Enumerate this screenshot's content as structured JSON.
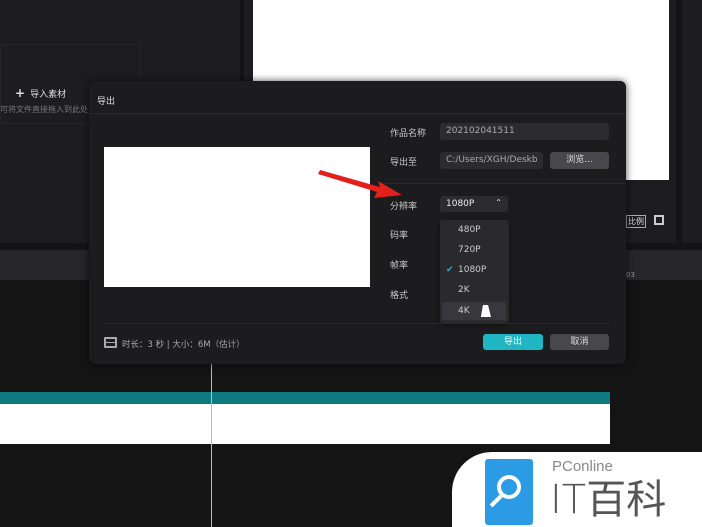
{
  "media_panel": {
    "import_label": "导入素材",
    "hint": "可将文件直接拖入到此处"
  },
  "dialog": {
    "title": "导出",
    "name_label": "作品名称",
    "name_value": "202102041511",
    "export_to_label": "导出至",
    "export_path": "C:/Users/XGH/Deskb",
    "browse_label": "浏览...",
    "resolution_label": "分辨率",
    "resolution_value": "1080P",
    "bitrate_label": "码率",
    "framerate_label": "帧率",
    "format_label": "格式",
    "resolution_options": [
      "480P",
      "720P",
      "1080P",
      "2K",
      "4K"
    ],
    "selected_option": "1080P",
    "hovered_option": "4K",
    "footer_info": "时长：3 秒 | 大小：6M（估计）",
    "export_button": "导出",
    "cancel_button": "取消"
  },
  "player": {
    "ratio_label": "比例"
  },
  "timeline": {
    "ruler_tick": "03"
  },
  "watermark": {
    "brand": "PConline",
    "name": "IT百科"
  },
  "colors": {
    "accent": "#1fb5c3",
    "arrow": "#e3201b",
    "track": "#0d7b80"
  }
}
